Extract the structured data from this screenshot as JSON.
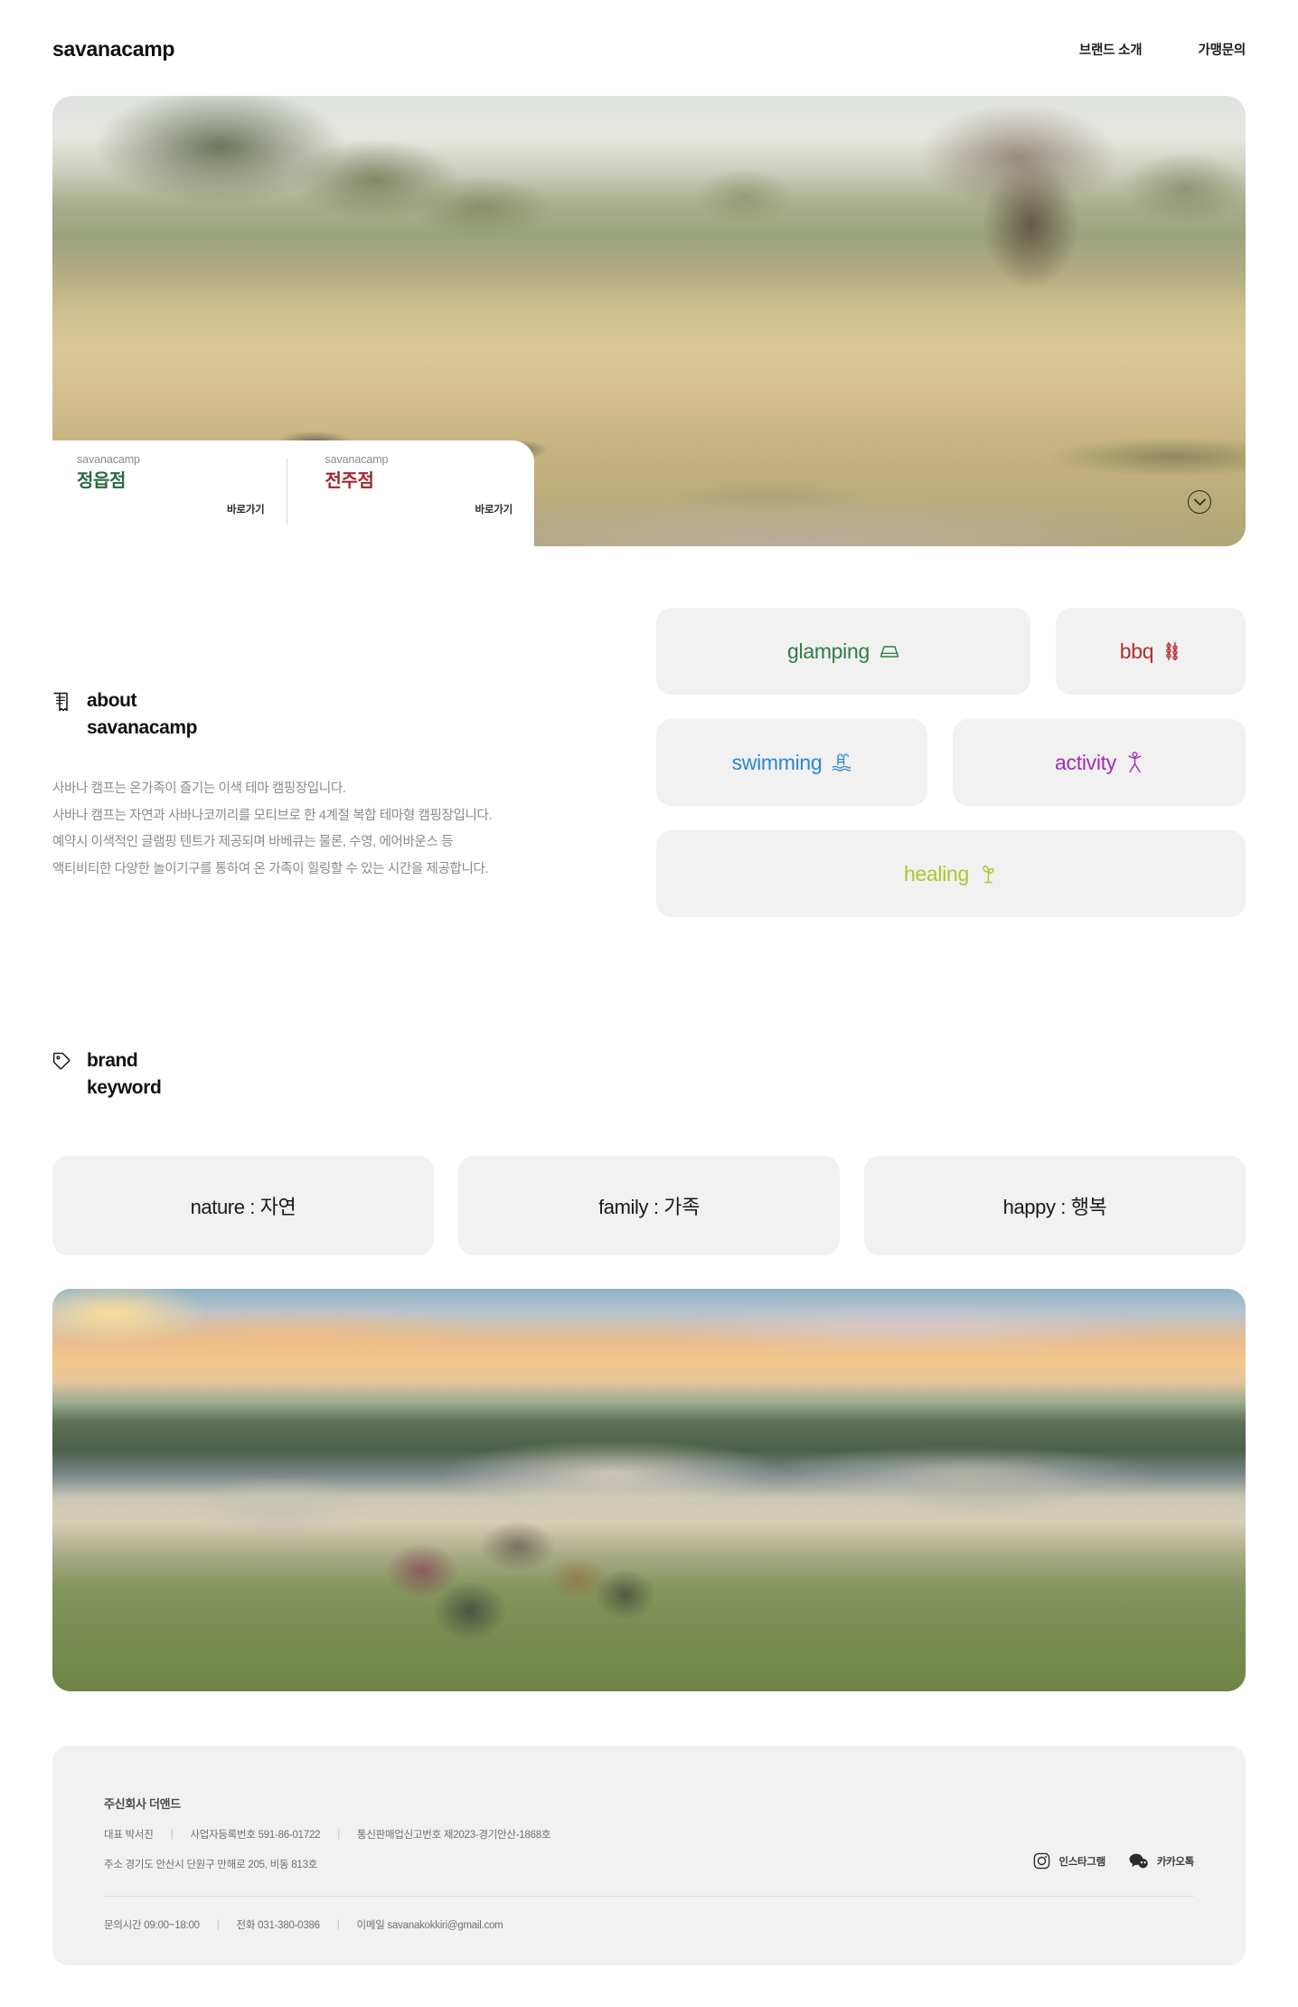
{
  "header": {
    "logo": "savanacamp",
    "nav": [
      {
        "label": "브랜드 소개"
      },
      {
        "label": "가맹문의"
      }
    ]
  },
  "hero": {
    "scroll_icon": "chevron-down-icon",
    "locations": [
      {
        "sub": "savanacamp",
        "name": "정읍점",
        "color": "#276b3f",
        "link": "바로가기"
      },
      {
        "sub": "savanacamp",
        "name": "전주점",
        "color": "#9e2630",
        "link": "바로가기"
      }
    ]
  },
  "about": {
    "icon": "document-icon",
    "title_line1": "about",
    "title_line2": "savanacamp",
    "paragraphs": [
      "사바나 캠프는 온가족이 즐기는 이색 테마 캠핑장입니다.",
      "사바나 캠프는 자연과 사바나코끼리를 모티브로 한 4계절 복합 테마형 캠핑장입니다.",
      "예약시 이색적인 글램핑 텐트가 제공되며 바베큐는 물론, 수영, 에어바운스 등",
      "액티비티한 다양한 놀이기구를 통하여 온 가족이 힐링할 수 있는 시간을 제공합니다."
    ]
  },
  "features": [
    {
      "label": "glamping",
      "icon": "tent-icon",
      "color": "#2f7d43"
    },
    {
      "label": "bbq",
      "icon": "skewer-icon",
      "color": "#b32d2d"
    },
    {
      "label": "swimming",
      "icon": "pool-icon",
      "color": "#2b87d1"
    },
    {
      "label": "activity",
      "icon": "person-icon",
      "color": "#a32bbf"
    },
    {
      "label": "healing",
      "icon": "seedling-icon",
      "color": "#a8c92b"
    }
  ],
  "keyword": {
    "icon": "tag-icon",
    "title_line1": "brand",
    "title_line2": "keyword",
    "cards": [
      {
        "label": "nature : 자연"
      },
      {
        "label": "family : 가족"
      },
      {
        "label": "happy : 행복"
      }
    ]
  },
  "footer": {
    "company": "주신회사 더앤드",
    "info_line": {
      "ceo": "대표 박서진",
      "biz_no": "사업자등록번호 591-86-01722",
      "mail_order": "통신판매업신고번호 제2023-경기안산-1868호"
    },
    "address": "주소 경기도 안산시 단원구 만해로 205, 비동 813호",
    "social": [
      {
        "label": "인스타그램",
        "icon": "instagram-icon"
      },
      {
        "label": "카카오톡",
        "icon": "kakaotalk-icon"
      }
    ],
    "contact": {
      "hours": "문의시간 09:00~18:00",
      "phone": "전화 031-380-0386",
      "email": "이메일 savanakokkiri@gmail.com"
    }
  }
}
